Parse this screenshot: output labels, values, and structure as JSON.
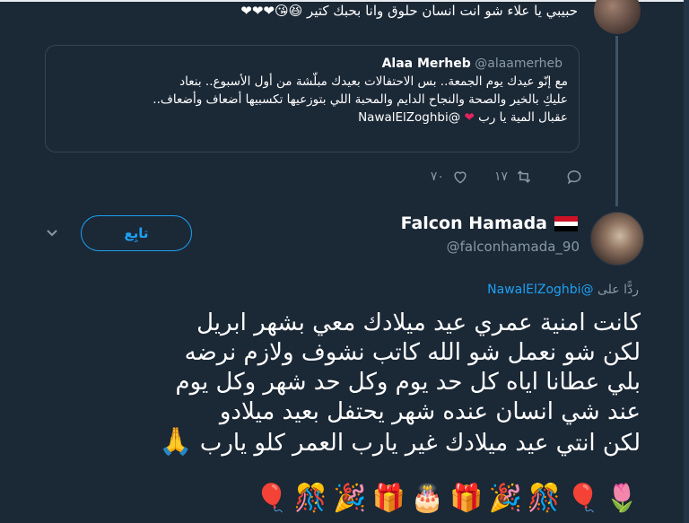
{
  "prev_tweet": {
    "text": "حبيبي يا علاء شو انت انسان حلوق وانا بحبك كتير",
    "trailing_emojis": "😆😘❤❤❤"
  },
  "quote": {
    "name": "Alaa Merheb",
    "handle": "@alaamerheb",
    "line1": "مع إنّو عيدك يوم الجمعة.. بس الاحتفالات بعيدك مبلّشة من أول الأسبوع.. بنعاد",
    "line2": "عليكِ بالخير والصحة والنجاح الدايم والمحبة اللي بتوزعيها تكسبيها أضعاف وأضعاف..",
    "line3": "عقبال المية يا رب",
    "mention": "@NawalElZoghbi"
  },
  "actions": {
    "reply_count": "",
    "retweet_count": "١٧",
    "like_count": "٧٠"
  },
  "user": {
    "name": "Falcon Hamada",
    "handle": "@falconhamada_90",
    "follow_label": "تابِع",
    "flag_colors": [
      "#ce1126",
      "#ffffff",
      "#000000"
    ]
  },
  "reply": {
    "prefix": "ردًّا على",
    "to": "@NawalElZoghbi"
  },
  "tweet": {
    "text": "كانت امنية عمري عيد ميلادك معي بشهر ابريل\nلكن شو نعمل شو الله كاتب نشوف ولازم نرضه\nبلي عطانا اياه كل حد يوم وكل حد شهر وكل يوم\nعند شي انسان عنده شهر يحتفل بعيد ميلادو\nلكن انتي عيد ميلادك غير يارب العمر كلو يارب",
    "pray_emoji": "🙏",
    "emojis": [
      "🌷",
      "🎈",
      "🎊",
      "🎉",
      "🎁",
      "🎂",
      "🎁",
      "🎉",
      "🎊",
      "🎈"
    ]
  }
}
